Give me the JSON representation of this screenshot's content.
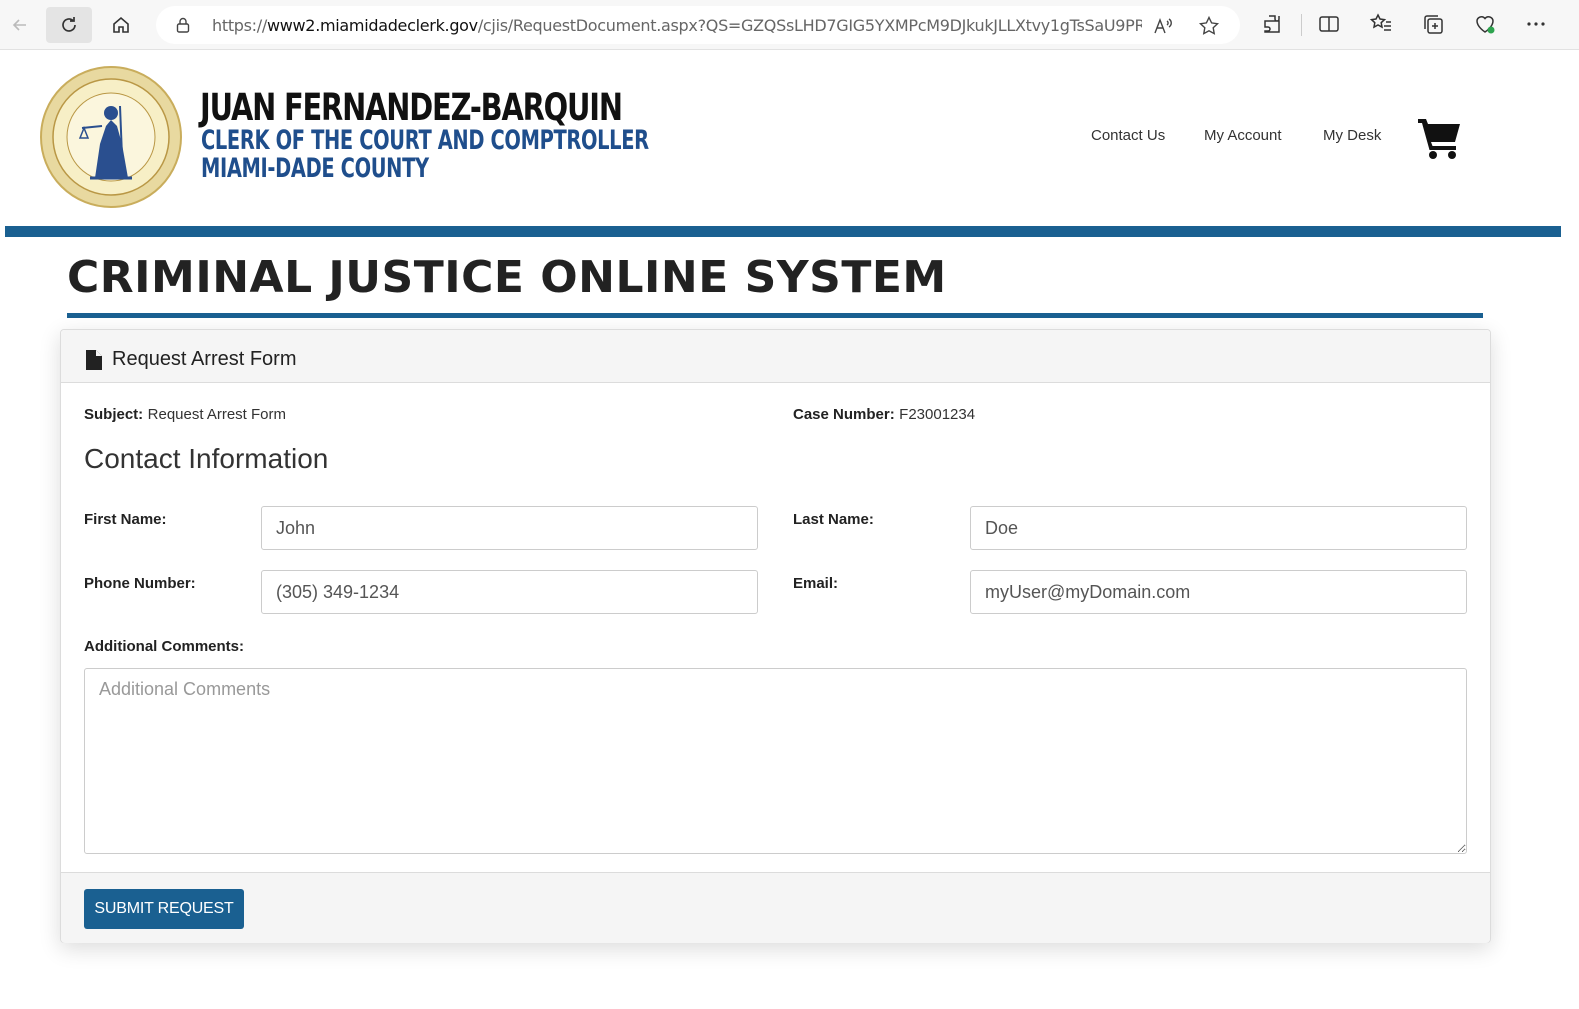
{
  "browser": {
    "url_scheme": "https://",
    "url_host": "www2.miamidadeclerk.gov",
    "url_path": "/cjis/RequestDocument.aspx?QS=GZQSsLHD7GIG5YXMPcM9DJkukJLLXtvy1gTsSaU9PRrGTg..."
  },
  "header": {
    "clerk_name": "JUAN FERNANDEZ-BARQUIN",
    "clerk_title": "CLERK OF THE COURT AND COMPTROLLER",
    "county": "MIAMI-DADE COUNTY",
    "nav": {
      "contact": "Contact Us",
      "account": "My Account",
      "desk": "My Desk"
    }
  },
  "page": {
    "system_title": "CRIMINAL JUSTICE ONLINE SYSTEM"
  },
  "panel": {
    "title": "Request Arrest Form",
    "subject_label": "Subject:",
    "subject_value": "Request Arrest Form",
    "case_label": "Case Number:",
    "case_value": "F23001234",
    "section_heading": "Contact Information"
  },
  "form": {
    "first_name_label": "First Name:",
    "first_name_value": "John",
    "last_name_label": "Last Name:",
    "last_name_value": "Doe",
    "phone_label": "Phone Number:",
    "phone_value": "(305) 349-1234",
    "email_label": "Email:",
    "email_value": "myUser@myDomain.com",
    "comments_label": "Additional Comments:",
    "comments_placeholder": "Additional Comments",
    "submit_label": "SUBMIT REQUEST"
  },
  "colors": {
    "brand_blue": "#1a6091",
    "title_blue": "#1f4e8c"
  }
}
